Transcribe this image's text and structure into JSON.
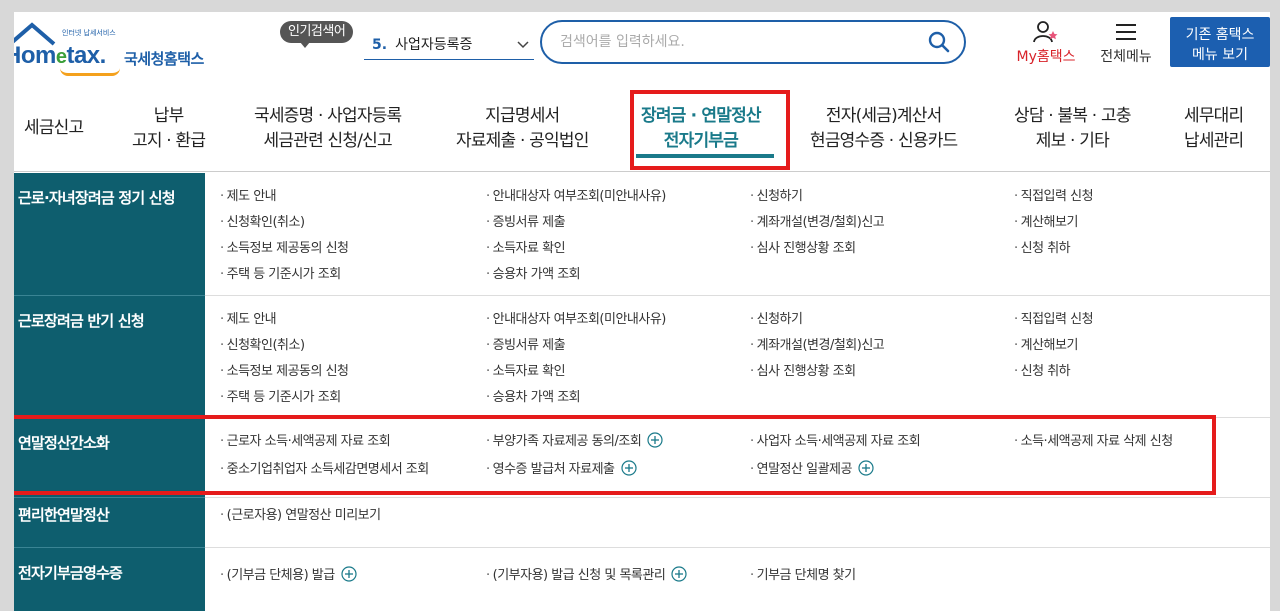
{
  "header": {
    "logo_sub": "인터넷 납세서비스",
    "logo_word_a": "Hom",
    "logo_word_e": "e",
    "logo_word_b": "tax.",
    "logo_kr": "국세청홈택스",
    "popular_badge": "인기검색어",
    "popular_num": "5.",
    "popular_term": "사업자등록증",
    "search_placeholder": "검색어를 입력하세요.",
    "my_label": "My홈택스",
    "allmenu_label": "전체메뉴",
    "old_menu_line1": "기존 홈택스",
    "old_menu_line2": "메뉴 보기"
  },
  "gnb": [
    {
      "l1": "세금신고",
      "l2": ""
    },
    {
      "l1": "납부",
      "l2": "고지 · 환급"
    },
    {
      "l1": "국세증명 · 사업자등록",
      "l2": "세금관련 신청/신고"
    },
    {
      "l1": "지급명세서",
      "l2": "자료제출 · 공익법인"
    },
    {
      "l1": "장려금 · 연말정산",
      "l2": "전자기부금"
    },
    {
      "l1": "전자(세금)계산서",
      "l2": "현금영수증 · 신용카드"
    },
    {
      "l1": "상담 · 불복 · 고충",
      "l2": "제보 · 기타"
    },
    {
      "l1": "세무대리",
      "l2": "납세관리"
    }
  ],
  "sections": [
    {
      "title": "근로·자녀장려금 정기 신청",
      "cols": [
        [
          "제도 안내",
          "신청확인(취소)",
          "소득정보 제공동의 신청",
          "주택 등 기준시가 조회"
        ],
        [
          "안내대상자 여부조회(미안내사유)",
          "증빙서류 제출",
          "소득자료 확인",
          "승용차 가액 조회"
        ],
        [
          "신청하기",
          "계좌개설(변경/철회)신고",
          "심사 진행상황 조회"
        ],
        [
          "직접입력 신청",
          "계산해보기",
          "신청 취하"
        ]
      ]
    },
    {
      "title": "근로장려금 반기 신청",
      "cols": [
        [
          "제도 안내",
          "신청확인(취소)",
          "소득정보 제공동의 신청",
          "주택 등 기준시가 조회"
        ],
        [
          "안내대상자 여부조회(미안내사유)",
          "증빙서류 제출",
          "소득자료 확인",
          "승용차 가액 조회"
        ],
        [
          "신청하기",
          "계좌개설(변경/철회)신고",
          "심사 진행상황 조회"
        ],
        [
          "직접입력 신청",
          "계산해보기",
          "신청 취하"
        ]
      ]
    },
    {
      "title": "연말정산간소화",
      "cols": [
        [
          "근로자 소득·세액공제 자료 조회",
          "중소기업취업자 소득세감면명세서 조회"
        ],
        [
          "부양가족 자료제공 동의/조회",
          "영수증 발급처 자료제출"
        ],
        [
          "사업자 소득·세액공제 자료 조회",
          "연말정산 일괄제공"
        ],
        [
          "소득·세액공제 자료 삭제 신청"
        ]
      ]
    },
    {
      "title": "편리한연말정산",
      "cols": [
        [
          "(근로자용) 연말정산 미리보기"
        ]
      ]
    },
    {
      "title": "전자기부금영수증",
      "cols": [
        [
          "(기부금 단체용) 발급"
        ],
        [
          "(기부자용) 발급 신청 및 목록관리"
        ],
        [
          "기부금 단체명 찾기"
        ]
      ]
    }
  ],
  "colors": {
    "brand": "#1e5fa8",
    "teal": "#0e5e6e",
    "active": "#1a7a8a",
    "highlight": "#e51b1b"
  }
}
